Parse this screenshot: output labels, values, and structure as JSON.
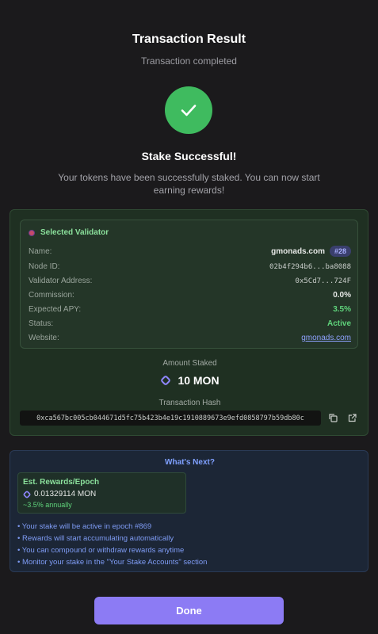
{
  "header": {
    "title": "Transaction Result",
    "subtitle": "Transaction completed"
  },
  "status": {
    "icon": "checkmark-icon",
    "color": "#3fbb5f",
    "title": "Stake Successful!",
    "message": "Your tokens have been successfully staked. You can now start earning rewards!"
  },
  "validator": {
    "heading": "Selected Validator",
    "rows": {
      "name_label": "Name:",
      "name_value": "gmonads.com",
      "name_badge": "#28",
      "node_label": "Node ID:",
      "node_value": "02b4f294b6...ba8088",
      "address_label": "Validator Address:",
      "address_value": "0x5Cd7...724F",
      "commission_label": "Commission:",
      "commission_value": "0.0%",
      "apy_label": "Expected APY:",
      "apy_value": "3.5%",
      "status_label": "Status:",
      "status_value": "Active",
      "website_label": "Website:",
      "website_value": "gmonads.com"
    }
  },
  "stake": {
    "amount_label": "Amount Staked",
    "amount_value": "10 MON",
    "hash_label": "Transaction Hash",
    "hash_value": "0xca567bc005cb044671d5fc75b423b4e19c1910889673e9efd0858797b59db80c"
  },
  "next": {
    "title": "What's Next?",
    "rewards_title": "Est. Rewards/Epoch",
    "rewards_value": "0.01329114 MON",
    "rewards_annual": "~3.5% annually",
    "bullets": [
      "Your stake will be active in epoch #869",
      "Rewards will start accumulating automatically",
      "You can compound or withdraw rewards anytime",
      "Monitor your stake in the \"Your Stake Accounts\" section"
    ]
  },
  "actions": {
    "done_label": "Done"
  },
  "colors": {
    "accent": "#8c7bf4",
    "success": "#3fbb5f",
    "link": "#8fa2ff"
  }
}
